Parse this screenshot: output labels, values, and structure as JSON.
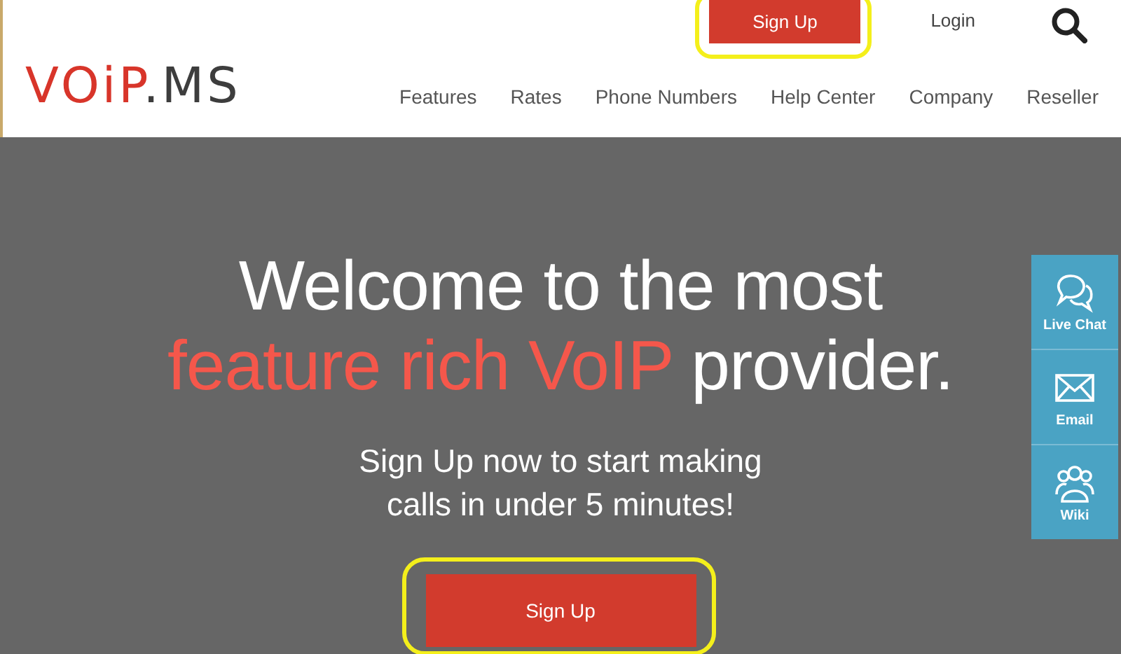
{
  "header": {
    "logo": {
      "brand": "VOiP",
      "suffix": ".MS"
    },
    "top_links": [
      {
        "kind": "button",
        "label": "Sign Up",
        "highlighted": true
      },
      {
        "kind": "link",
        "label": "Login"
      }
    ],
    "nav": [
      "Features",
      "Rates",
      "Phone Numbers",
      "Help Center",
      "Company",
      "Reseller"
    ]
  },
  "hero": {
    "headline": [
      [
        {
          "text": "Welcome to the most",
          "accent": false
        }
      ],
      [
        {
          "text": "feature rich VoIP",
          "accent": true
        },
        {
          "text": " provider.",
          "accent": false
        }
      ]
    ],
    "subtitle": [
      "Sign Up now to start making",
      "calls in under 5 minutes!"
    ],
    "button": {
      "label": "Sign Up",
      "highlighted": true
    }
  },
  "side_widget": [
    {
      "kind": "chat",
      "label": "Live Chat"
    },
    {
      "kind": "email",
      "label": "Email"
    },
    {
      "kind": "wiki",
      "label": "Wiki"
    }
  ]
}
